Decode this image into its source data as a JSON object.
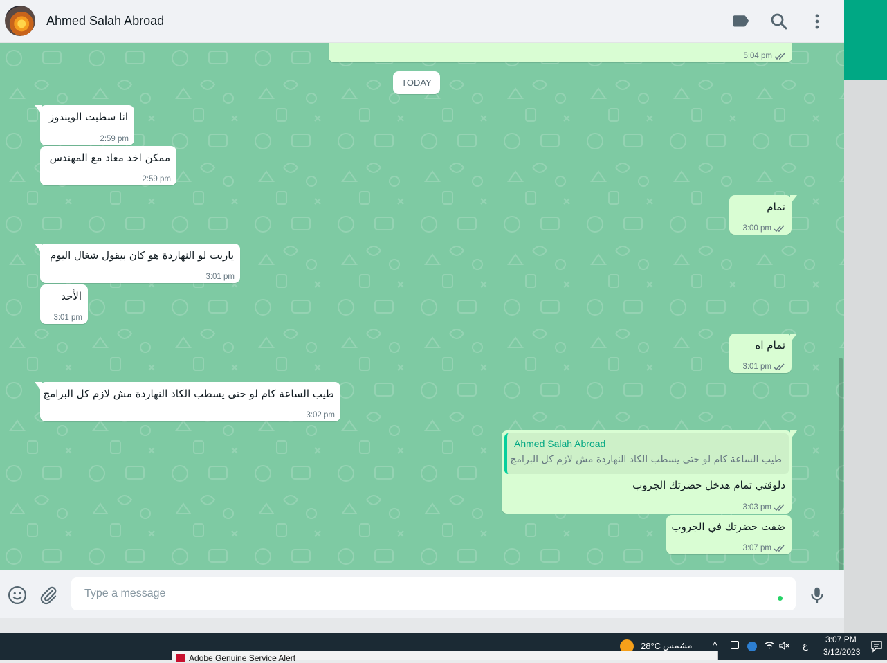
{
  "header": {
    "contact_name": "Ahmed Salah Abroad",
    "icons": [
      "label-icon",
      "search-icon",
      "menu-icon"
    ]
  },
  "chat": {
    "date_divider": "TODAY",
    "messages": [
      {
        "dir": "out",
        "text": "",
        "time": "5:04 pm",
        "ticks": true
      },
      {
        "dir": "in",
        "text": "انا سطبت الويندوز",
        "time": "2:59 pm"
      },
      {
        "dir": "in",
        "text": "ممكن اخد معاد مع المهندس",
        "time": "2:59 pm"
      },
      {
        "dir": "out",
        "text": "تمام",
        "time": "3:00 pm",
        "ticks": true
      },
      {
        "dir": "in",
        "text": "ياريت لو النهاردة هو كان بيقول شغال اليوم",
        "time": "3:01 pm"
      },
      {
        "dir": "in",
        "text": "الأحد",
        "time": "3:01 pm"
      },
      {
        "dir": "out",
        "text": "تمام اه",
        "time": "3:01 pm",
        "ticks": true
      },
      {
        "dir": "in",
        "text": "طيب الساعة كام لو حتى يسطب الكاد النهاردة مش لازم كل البرامج",
        "time": "3:02 pm"
      },
      {
        "dir": "out",
        "quote_name": "Ahmed Salah Abroad",
        "quote_text": "طيب الساعة كام لو حتى يسطب الكاد النهاردة مش لازم كل البرامج",
        "text": "دلوقتي تمام هدخل حضرتك الجروب",
        "time": "3:03 pm",
        "ticks": true
      },
      {
        "dir": "out",
        "text": "ضفت حضرتك في الجروب",
        "time": "3:07 pm",
        "ticks": true
      }
    ]
  },
  "composer": {
    "placeholder": "Type a message",
    "icons": [
      "emoji-icon",
      "attach-icon",
      "mic-icon"
    ]
  },
  "taskbar": {
    "weather_temp": "28°C",
    "weather_label": "مشمس",
    "keyboard_lang": "ع",
    "clock_time": "3:07 PM",
    "clock_date": "3/12/2023",
    "alert_window_title": "Adobe Genuine Service Alert"
  },
  "colors": {
    "chat_bg": "#7ecaa3",
    "incoming_bubble": "#ffffff",
    "outgoing_bubble": "#d9fdd3",
    "accent": "#00a884",
    "tick": "#667781"
  }
}
